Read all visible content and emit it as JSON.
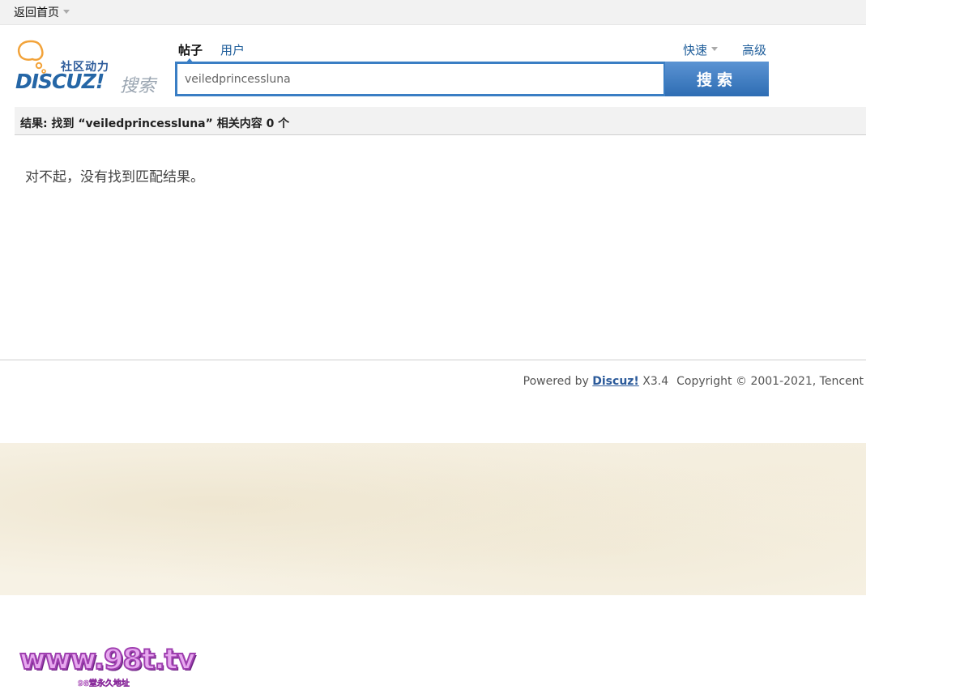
{
  "topbar": {
    "home_label": "返回首页"
  },
  "logo": {
    "tagline": "社区动力",
    "wordmark": "DISCUZ!",
    "search_word": "搜索"
  },
  "search": {
    "tabs": [
      {
        "label": "帖子",
        "active": true
      },
      {
        "label": "用户",
        "active": false
      }
    ],
    "quick_label": "快速",
    "advanced_label": "高级",
    "query": "veiledprincessluna",
    "button_label": "搜索"
  },
  "results": {
    "summary": "结果: 找到 “veiledprincessluna” 相关内容 0 个",
    "empty_message": "对不起，没有找到匹配结果。"
  },
  "footer": {
    "powered_by": "Powered by",
    "brand": "Discuz!",
    "version": "X3.4",
    "copyright": "Copyright © 2001-2021, Tencent"
  },
  "watermark": {
    "main": "www.98t.tv",
    "sub": "98堂永久地址"
  },
  "colors": {
    "link": "#1e5d9a",
    "accent": "#3a7ec4",
    "parchment": "#f7f2e5"
  }
}
